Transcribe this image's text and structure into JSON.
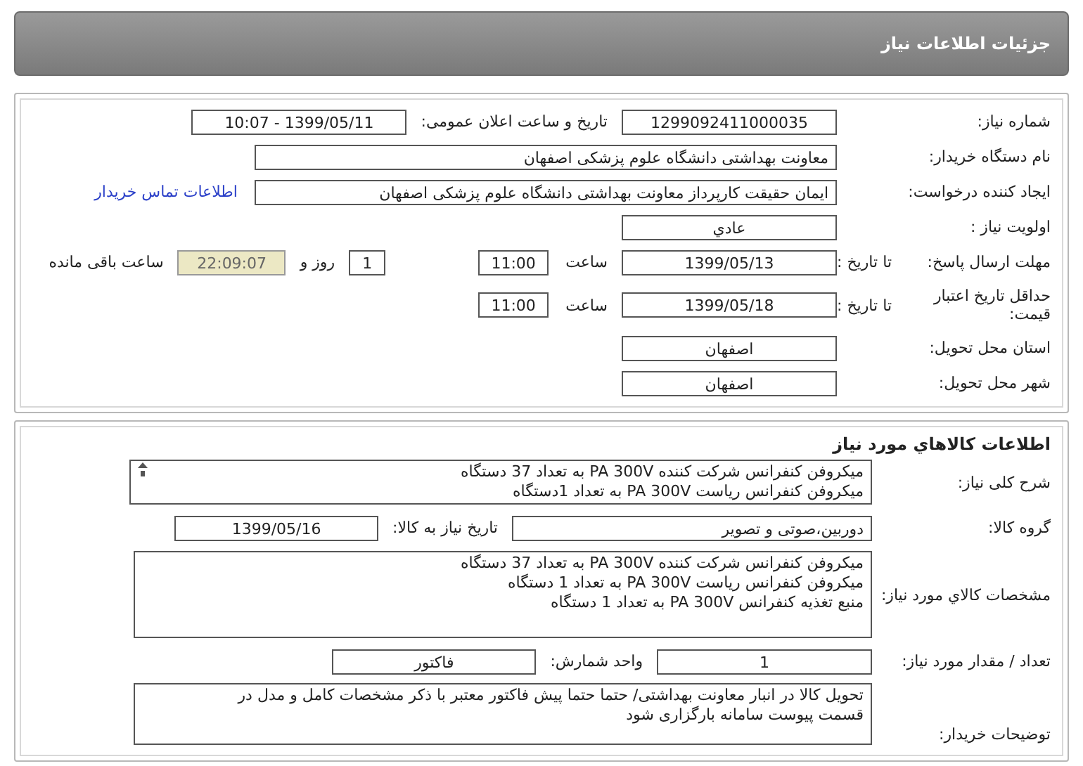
{
  "header": {
    "title": "جزئیات اطلاعات نیاز"
  },
  "details": {
    "rows": [
      {
        "label": "شماره نیاز:",
        "items": [
          {
            "kind": "field",
            "text": "1299092411000035"
          },
          {
            "kind": "label",
            "text": "تاریخ و ساعت اعلان عمومی:"
          },
          {
            "kind": "field",
            "text": "1399/05/11 - 10:07"
          }
        ]
      },
      {
        "label": "نام دستگاه خریدار:",
        "items": [
          {
            "kind": "long-field",
            "text": "معاونت بهداشتی دانشگاه علوم پزشکی اصفهان"
          }
        ]
      },
      {
        "label": "ایجاد کننده درخواست:",
        "items": [
          {
            "kind": "long-field",
            "text": "ایمان حقیقت کارپرداز معاونت بهداشتی دانشگاه علوم پزشکی اصفهان"
          },
          {
            "kind": "link",
            "text": "اطلاعات تماس خریدار"
          }
        ]
      },
      {
        "label": "اولویت نیاز :",
        "items": [
          {
            "kind": "field",
            "text": "عادي"
          }
        ]
      },
      {
        "label": "مهلت ارسال پاسخ:",
        "sublabel": "تا تاریخ :",
        "items": [
          {
            "kind": "field",
            "text": "1399/05/13"
          },
          {
            "kind": "label",
            "text": "ساعت"
          },
          {
            "kind": "small-field",
            "text": "11:00"
          },
          {
            "kind": "tiny-field",
            "text": "1"
          },
          {
            "kind": "label",
            "text": "روز و"
          },
          {
            "kind": "timer",
            "text": "22:09:07"
          },
          {
            "kind": "label",
            "text": "ساعت باقی مانده"
          }
        ]
      },
      {
        "label": "حداقل تاریخ اعتبار قیمت:",
        "sublabel": "تا تاریخ :",
        "items": [
          {
            "kind": "field",
            "text": "1399/05/18"
          },
          {
            "kind": "label",
            "text": "ساعت"
          },
          {
            "kind": "small-field",
            "text": "11:00"
          }
        ]
      },
      {
        "label": "استان محل تحویل:",
        "items": [
          {
            "kind": "field",
            "text": "اصفهان"
          }
        ]
      },
      {
        "label": "شهر محل تحویل:",
        "items": [
          {
            "kind": "field",
            "text": "اصفهان"
          }
        ]
      }
    ]
  },
  "goods": {
    "title": "اطلاعات کالاهاي مورد نیاز",
    "rows": [
      {
        "label": "شرح کلی نیاز:",
        "items": [
          {
            "kind": "scroll-area",
            "lines": [
              "میکروفن کنفرانس شرکت کننده PA 300V به تعداد 37 دستگاه",
              "میکروفن کنفرانس ریاست PA 300V به تعداد 1دستگاه"
            ]
          }
        ]
      },
      {
        "label": "گروه کالا:",
        "items": [
          {
            "kind": "group-field",
            "text": "دوربین،صوتی و تصویر"
          },
          {
            "kind": "label",
            "text": "تاریخ نیاز به کالا:"
          },
          {
            "kind": "date-field",
            "text": "1399/05/16"
          }
        ]
      },
      {
        "label": "مشخصات کالاي مورد نیاز:",
        "items": [
          {
            "kind": "text-area",
            "lines": [
              "میکروفن کنفرانس شرکت کننده PA 300V به تعداد 37 دستگاه",
              "میکروفن کنفرانس ریاست PA 300V به تعداد 1 دستگاه",
              "منبع تغذیه کنفرانس  PA 300V به تعداد 1 دستگاه"
            ]
          }
        ]
      },
      {
        "label": "تعداد / مقدار مورد نیاز:",
        "items": [
          {
            "kind": "field",
            "text": "1"
          },
          {
            "kind": "label",
            "text": "واحد شمارش:"
          },
          {
            "kind": "date-field",
            "text": "فاکتور"
          }
        ]
      },
      {
        "label": "توضیحات خریدار:",
        "items": [
          {
            "kind": "comment-area",
            "lines": [
              "تحویل کالا در انبار معاونت بهداشتی/ حتما حتما پیش فاکتور معتبر با ذکر مشخصات کامل و مدل در",
              "قسمت پیوست سامانه بارگزاری شود"
            ]
          }
        ]
      }
    ]
  }
}
